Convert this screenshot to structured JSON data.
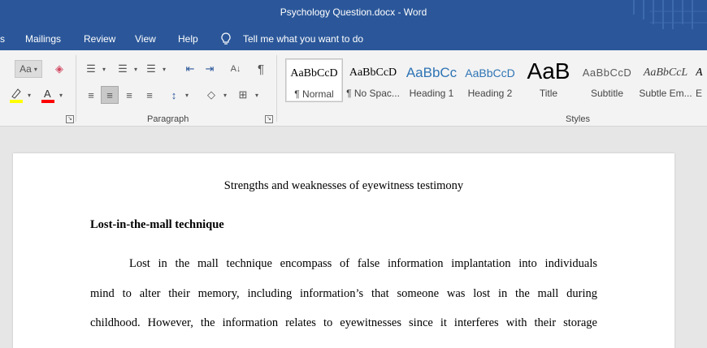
{
  "window": {
    "title": "Psychology Question.docx  -  Word"
  },
  "menu": {
    "items": [
      "s",
      "Mailings",
      "Review",
      "View",
      "Help"
    ],
    "tell_me": "Tell me what you want to do"
  },
  "ribbon": {
    "font_case_label": "Aa",
    "paragraph_label": "Paragraph",
    "styles_label": "Styles",
    "styles": [
      {
        "preview": "AaBbCcD",
        "name": "¶ Normal"
      },
      {
        "preview": "AaBbCcD",
        "name": "¶ No Spac..."
      },
      {
        "preview": "AaBbCc",
        "name": "Heading 1"
      },
      {
        "preview": "AaBbCcD",
        "name": "Heading 2"
      },
      {
        "preview": "AaB",
        "name": "Title"
      },
      {
        "preview": "AaBbCcD",
        "name": "Subtitle"
      },
      {
        "preview": "AaBbCcL",
        "name": "Subtle Em..."
      },
      {
        "preview": "A",
        "name": "E"
      }
    ]
  },
  "document": {
    "title": "Strengths and weaknesses of eyewitness testimony",
    "heading": "Lost-in-the-mall technique",
    "lines": [
      "Lost in the mall technique encompass of false information implantation into individuals",
      "mind to alter their memory, including information’s that someone was lost in the mall during",
      "childhood. However, the information relates to eyewitnesses since it interferes with their storage"
    ]
  },
  "colors": {
    "brand": "#2b579a",
    "ribbon_bg": "#f3f3f3",
    "workspace": "#e6e6e6",
    "highlight": "#ffff00",
    "font_color": "#ff0000"
  }
}
